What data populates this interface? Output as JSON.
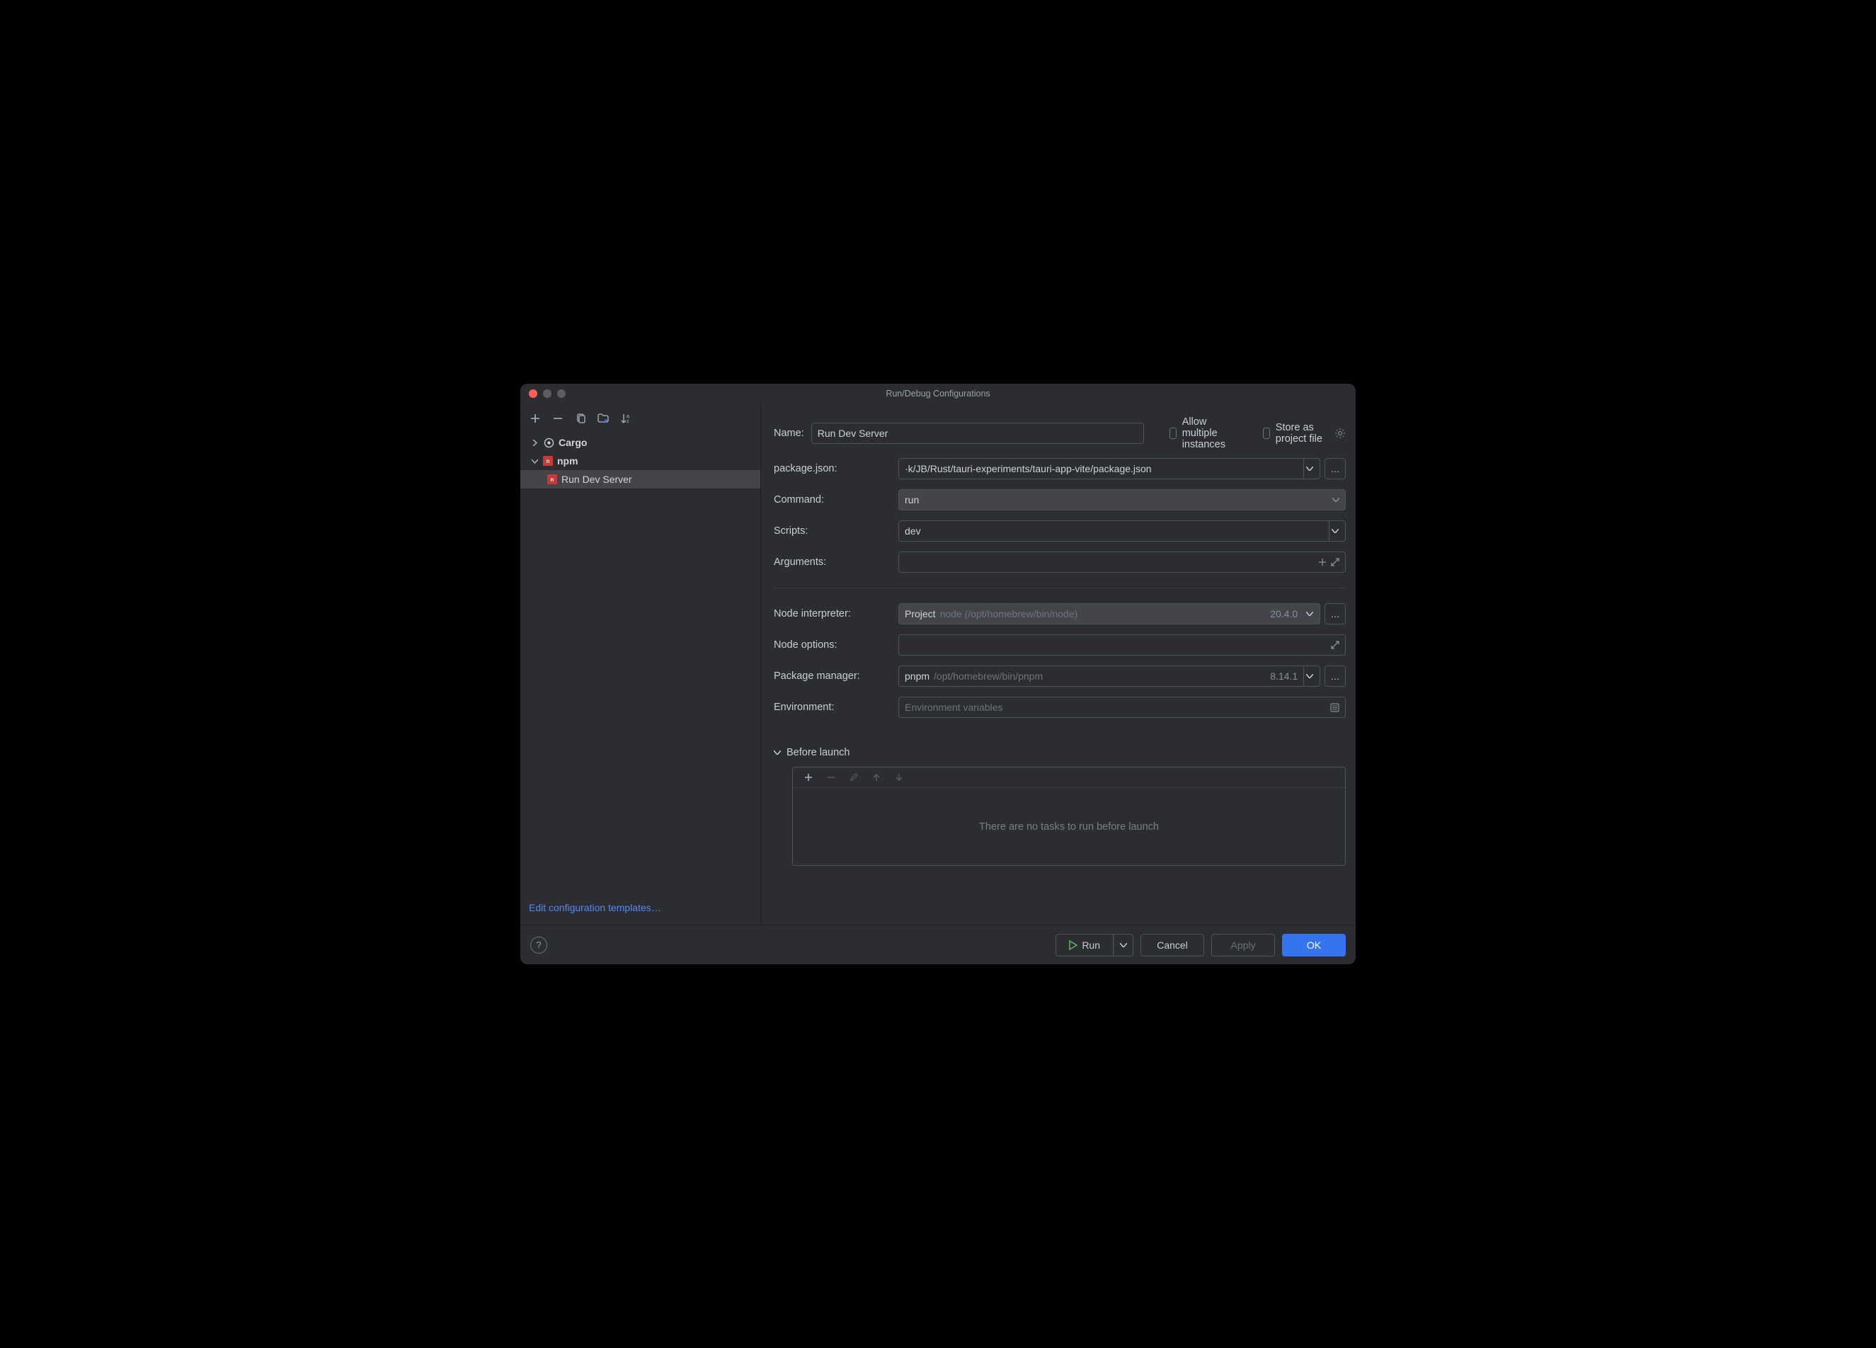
{
  "window": {
    "title": "Run/Debug Configurations"
  },
  "sidebar": {
    "items": [
      {
        "label": "Cargo",
        "expanded": false
      },
      {
        "label": "npm",
        "expanded": true,
        "children": [
          {
            "label": "Run Dev Server",
            "selected": true
          }
        ]
      }
    ],
    "footer_link": "Edit configuration templates…"
  },
  "form": {
    "name": {
      "label": "Name:",
      "value": "Run Dev Server"
    },
    "allow_multiple": "Allow multiple instances",
    "store_as_project": "Store as project file",
    "package_json": {
      "label": "package.json:",
      "value": "·k/JB/Rust/tauri-experiments/tauri-app-vite/package.json"
    },
    "command": {
      "label": "Command:",
      "value": "run"
    },
    "scripts": {
      "label": "Scripts:",
      "value": "dev"
    },
    "arguments": {
      "label": "Arguments:"
    },
    "node_interpreter": {
      "label": "Node interpreter:",
      "prefix": "Project",
      "path": "node (/opt/homebrew/bin/node)",
      "version": "20.4.0"
    },
    "node_options": {
      "label": "Node options:"
    },
    "package_manager": {
      "label": "Package manager:",
      "name": "pnpm",
      "path": "/opt/homebrew/bin/pnpm",
      "version": "8.14.1"
    },
    "environment": {
      "label": "Environment:",
      "placeholder": "Environment variables"
    },
    "before_launch": {
      "title": "Before launch",
      "empty": "There are no tasks to run before launch"
    }
  },
  "footer": {
    "run": "Run",
    "cancel": "Cancel",
    "apply": "Apply",
    "ok": "OK"
  }
}
